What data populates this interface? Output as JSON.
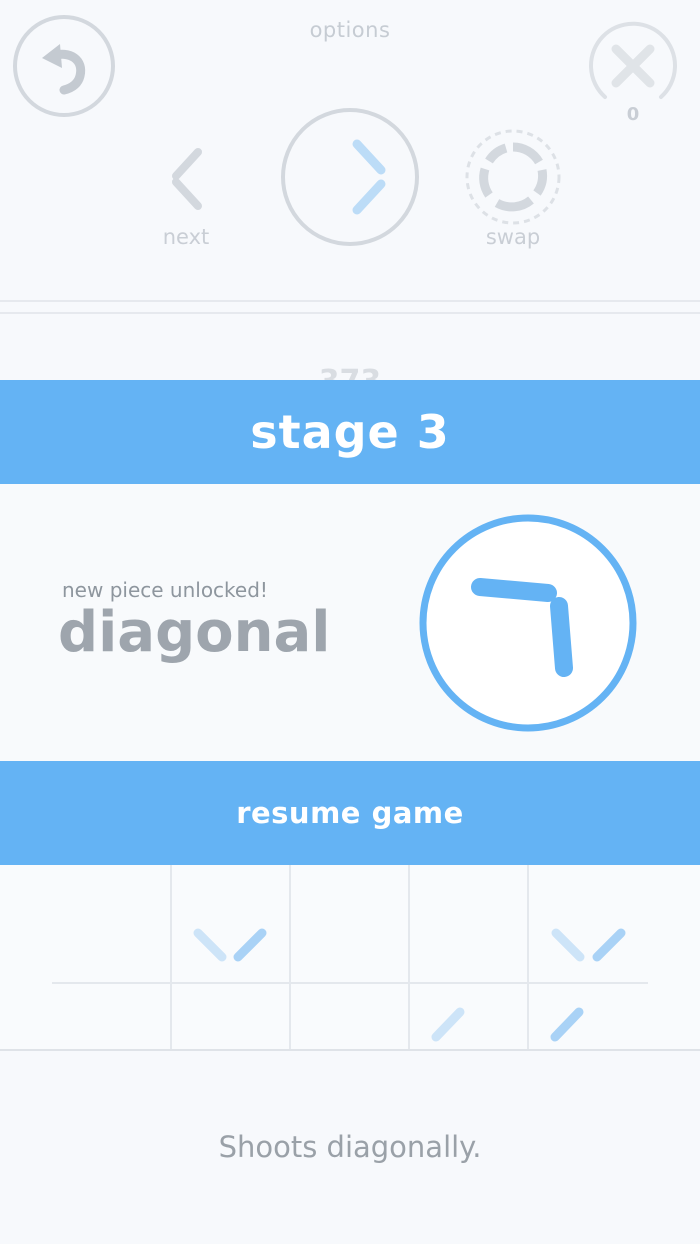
{
  "header": {
    "options_label": "options",
    "close_count": "0",
    "next_label": "next",
    "swap_label": "swap"
  },
  "score_partial": "373",
  "stage": {
    "title": "stage 3"
  },
  "unlock": {
    "caption": "new piece unlocked!",
    "piece_name": "diagonal"
  },
  "resume": {
    "label": "resume game"
  },
  "board": {
    "description": "Shoots diagonally."
  },
  "colors": {
    "accent": "#64b3f4",
    "muted_text": "#9ea5ad",
    "light_gray": "#d3d8de"
  },
  "icons": {
    "undo": "undo-arrow-icon",
    "close": "close-x-icon",
    "next": "chevron-left-icon",
    "play": "chevron-right-icon",
    "swap": "swap-ring-icon",
    "piece": "diagonal-piece-icon"
  }
}
